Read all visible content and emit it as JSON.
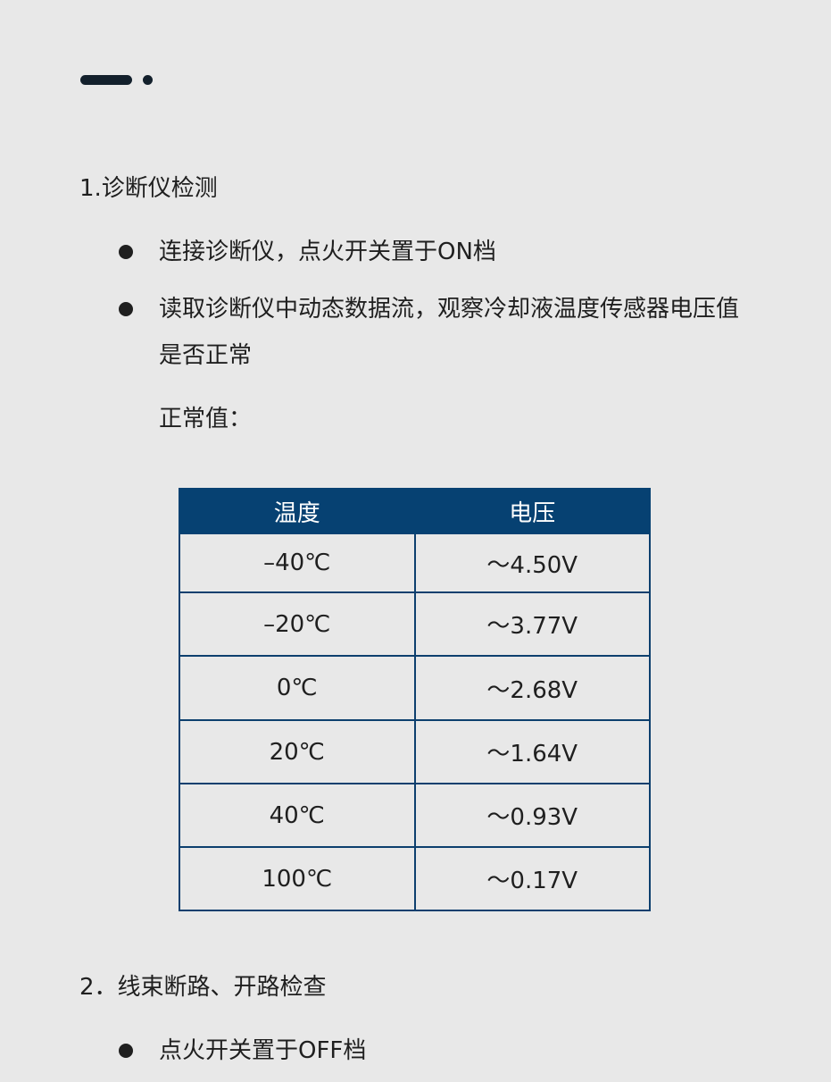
{
  "section1": {
    "title": "1.诊断仪检测",
    "bullets": [
      "连接诊断仪，点火开关置于ON档",
      "读取诊断仪中动态数据流，观察冷却液温度传感器电压值是否正常"
    ],
    "normal_label": "正常值："
  },
  "table": {
    "headers": [
      "温度",
      "电压"
    ],
    "rows": [
      [
        "–40℃",
        "～4.50V"
      ],
      [
        "–20℃",
        "～3.77V"
      ],
      [
        "0℃",
        "～2.68V"
      ],
      [
        "20℃",
        "～1.64V"
      ],
      [
        "40℃",
        "～0.93V"
      ],
      [
        "100℃",
        "～0.17V"
      ]
    ]
  },
  "section2": {
    "title": "2．线束断路、开路检查",
    "bullets": [
      "点火开关置于OFF档"
    ]
  }
}
